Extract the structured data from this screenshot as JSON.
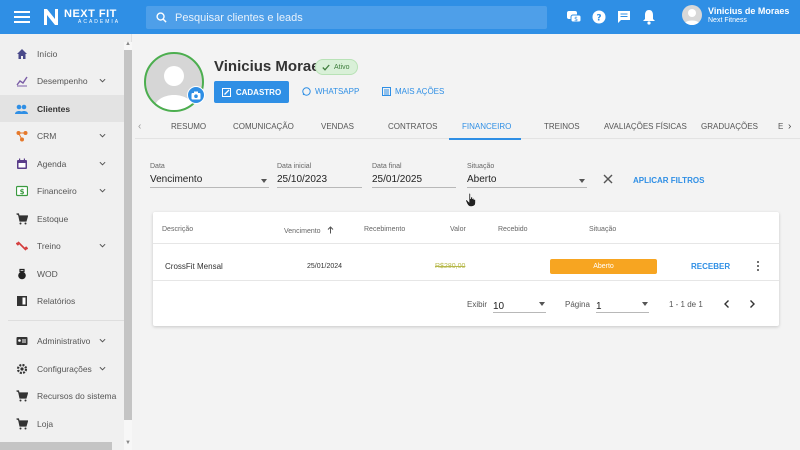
{
  "topbar": {
    "logo_text": "NEXT FIT",
    "logo_sub": "ACADEMIA",
    "search_placeholder": "Pesquisar clientes e leads",
    "user_name": "Vinicius de Moraes",
    "user_org": "Next Fitness",
    "icons": [
      "chat-bubbles-icon",
      "help-icon",
      "message-icon",
      "bell-icon"
    ]
  },
  "sidebar": {
    "items": [
      {
        "label": "Início",
        "icon": "home-icon"
      },
      {
        "label": "Desempenho",
        "icon": "chart-line-icon",
        "expandable": true
      },
      {
        "label": "Clientes",
        "icon": "people-icon",
        "active": true
      },
      {
        "label": "CRM",
        "icon": "crm-icon",
        "expandable": true
      },
      {
        "label": "Agenda",
        "icon": "calendar-icon",
        "expandable": true
      },
      {
        "label": "Financeiro",
        "icon": "dollar-icon",
        "expandable": true
      },
      {
        "label": "Estoque",
        "icon": "cart-icon"
      },
      {
        "label": "Treino",
        "icon": "dumbbell-icon",
        "expandable": true
      },
      {
        "label": "WOD",
        "icon": "kettlebell-icon"
      },
      {
        "label": "Relatórios",
        "icon": "report-icon"
      },
      {
        "label": "Administrativo",
        "icon": "id-card-icon",
        "expandable": true
      },
      {
        "label": "Configurações",
        "icon": "gear-icon",
        "expandable": true
      },
      {
        "label": "Recursos do sistema",
        "icon": "cart-icon"
      },
      {
        "label": "Loja",
        "icon": "cart-icon"
      }
    ]
  },
  "profile": {
    "name": "Vinicius Moraes",
    "status": "Ativo",
    "btn_cadastro": "CADASTRO",
    "btn_whatsapp": "WHATSAPP",
    "btn_mais": "MAIS AÇÕES"
  },
  "tabs": [
    "RESUMO",
    "COMUNICAÇÃO",
    "VENDAS",
    "CONTRATOS",
    "FINANCEIRO",
    "TREINOS",
    "AVALIAÇÕES FÍSICAS",
    "GRADUAÇÕES",
    "E"
  ],
  "active_tab": "FINANCEIRO",
  "filters": {
    "data": {
      "label": "Data",
      "value": "Vencimento"
    },
    "data_inicial": {
      "label": "Data inicial",
      "value": "25/10/2023"
    },
    "data_final": {
      "label": "Data final",
      "value": "25/01/2025"
    },
    "situacao": {
      "label": "Situação",
      "value": "Aberto"
    },
    "apply_label": "APLICAR FILTROS"
  },
  "table": {
    "headers": [
      "Descrição",
      "Vencimento",
      "Recebimento",
      "Valor",
      "Recebido",
      "Situação"
    ],
    "rows": [
      {
        "descricao": "CrossFit Mensal",
        "vencimento": "25/01/2024",
        "recebimento": "",
        "valor": "R$280,00",
        "recebido": "",
        "situacao": "Aberto",
        "action": "RECEBER"
      }
    ]
  },
  "pagination": {
    "exibir_label": "Exibir",
    "exibir_value": "10",
    "pagina_label": "Página",
    "pagina_value": "1",
    "range": "1 - 1 de 1"
  },
  "colors": {
    "primary": "#2f8fe5",
    "status_open": "#f7a521",
    "active_badge": "#d9f0d8",
    "avatar_border": "#4cae4f"
  }
}
